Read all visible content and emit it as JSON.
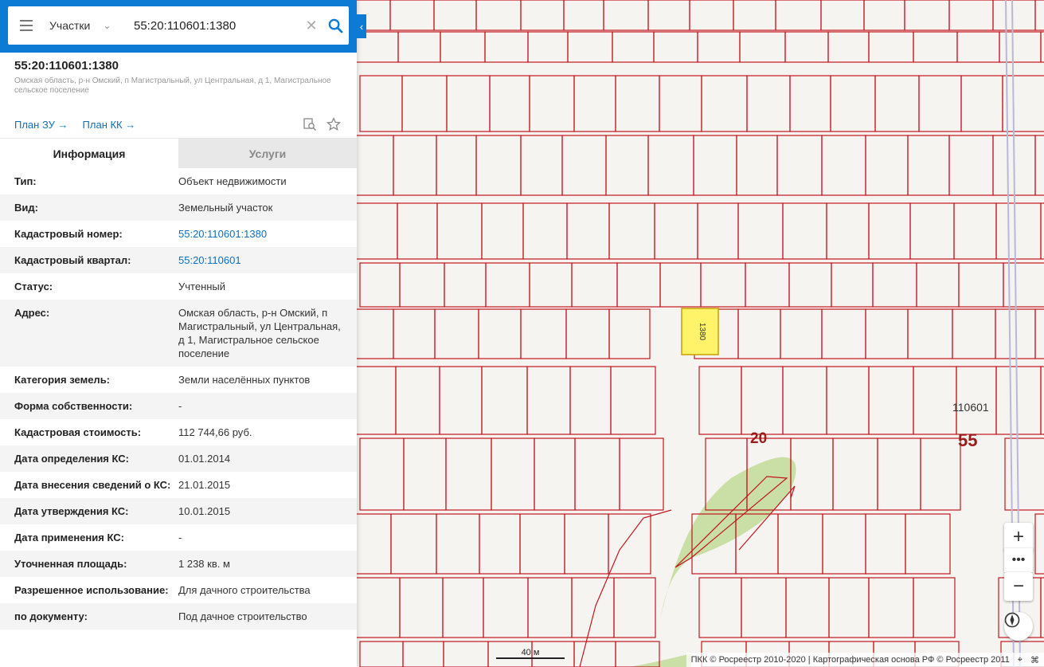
{
  "search": {
    "type_label": "Участки",
    "query": "55:20:110601:1380"
  },
  "object": {
    "title": "55:20:110601:1380",
    "address": "Омская область, р-н Омский, п Магистральный, ул Центральная, д 1, Магистральное сельское поселение"
  },
  "plans": {
    "plan_zu": "План ЗУ →",
    "plan_kk": "План КК →"
  },
  "tabs": {
    "info": "Информация",
    "services": "Услуги"
  },
  "properties": [
    {
      "k": "Тип:",
      "v": "Объект недвижимости"
    },
    {
      "k": "Вид:",
      "v": "Земельный участок"
    },
    {
      "k": "Кадастровый номер:",
      "v": "55:20:110601:1380",
      "link": true
    },
    {
      "k": "Кадастровый квартал:",
      "v": "55:20:110601",
      "link": true
    },
    {
      "k": "Статус:",
      "v": "Учтенный"
    },
    {
      "k": "Адрес:",
      "v": "Омская область, р-н Омский, п Магистральный, ул Центральная, д 1, Магистральное сельское поселение"
    },
    {
      "k": "Категория земель:",
      "v": "Земли населённых пунктов"
    },
    {
      "k": "Форма собственности:",
      "v": "-"
    },
    {
      "k": "Кадастровая стоимость:",
      "v": "112 744,66 руб."
    },
    {
      "k": "Дата определения КС:",
      "v": "01.01.2014"
    },
    {
      "k": "Дата внесения сведений о КС:",
      "v": "21.01.2015"
    },
    {
      "k": "Дата утверждения КС:",
      "v": "10.01.2015"
    },
    {
      "k": "Дата применения КС:",
      "v": "-"
    },
    {
      "k": "Уточненная площадь:",
      "v": "1 238 кв. м"
    },
    {
      "k": "Разрешенное использование:",
      "v": "Для дачного строительства"
    },
    {
      "k": "по документу:",
      "v": "Под дачное строительство"
    }
  ],
  "map": {
    "selected_parcel": "1380",
    "quarter_label": "110601",
    "district_label": "20",
    "region_label": "55",
    "scale_label": "40 м",
    "attribution": "ПКК © Росреестр 2010-2020 | Картографическая основа РФ © Росреестр 2011",
    "colors": {
      "parcel_border": "#c0161e",
      "selected_fill": "#fff36a",
      "green_area": "#c9dfa6"
    }
  }
}
